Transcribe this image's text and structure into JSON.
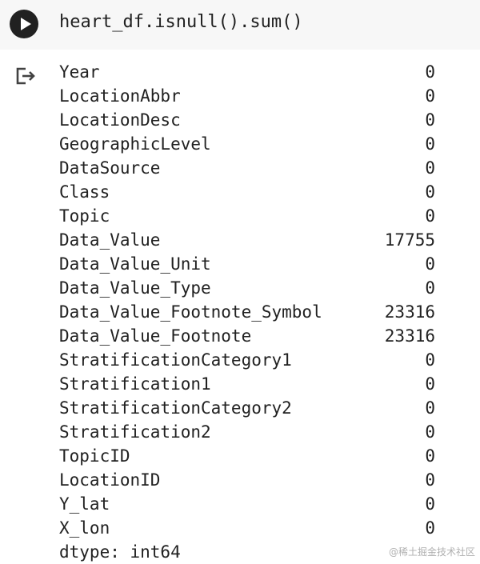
{
  "code_cell": {
    "code": "heart_df.isnull().sum()",
    "run_icon": "play-icon"
  },
  "output": {
    "icon": "output-redirect-icon",
    "rows": [
      {
        "name": "Year",
        "value": "0"
      },
      {
        "name": "LocationAbbr",
        "value": "0"
      },
      {
        "name": "LocationDesc",
        "value": "0"
      },
      {
        "name": "GeographicLevel",
        "value": "0"
      },
      {
        "name": "DataSource",
        "value": "0"
      },
      {
        "name": "Class",
        "value": "0"
      },
      {
        "name": "Topic",
        "value": "0"
      },
      {
        "name": "Data_Value",
        "value": "17755"
      },
      {
        "name": "Data_Value_Unit",
        "value": "0"
      },
      {
        "name": "Data_Value_Type",
        "value": "0"
      },
      {
        "name": "Data_Value_Footnote_Symbol",
        "value": "23316"
      },
      {
        "name": "Data_Value_Footnote",
        "value": "23316"
      },
      {
        "name": "StratificationCategory1",
        "value": "0"
      },
      {
        "name": "Stratification1",
        "value": "0"
      },
      {
        "name": "StratificationCategory2",
        "value": "0"
      },
      {
        "name": "Stratification2",
        "value": "0"
      },
      {
        "name": "TopicID",
        "value": "0"
      },
      {
        "name": "LocationID",
        "value": "0"
      },
      {
        "name": "Y_lat",
        "value": "0"
      },
      {
        "name": "X_lon",
        "value": "0"
      }
    ],
    "dtype": "dtype: int64"
  },
  "watermark": "@稀土掘金技术社区"
}
